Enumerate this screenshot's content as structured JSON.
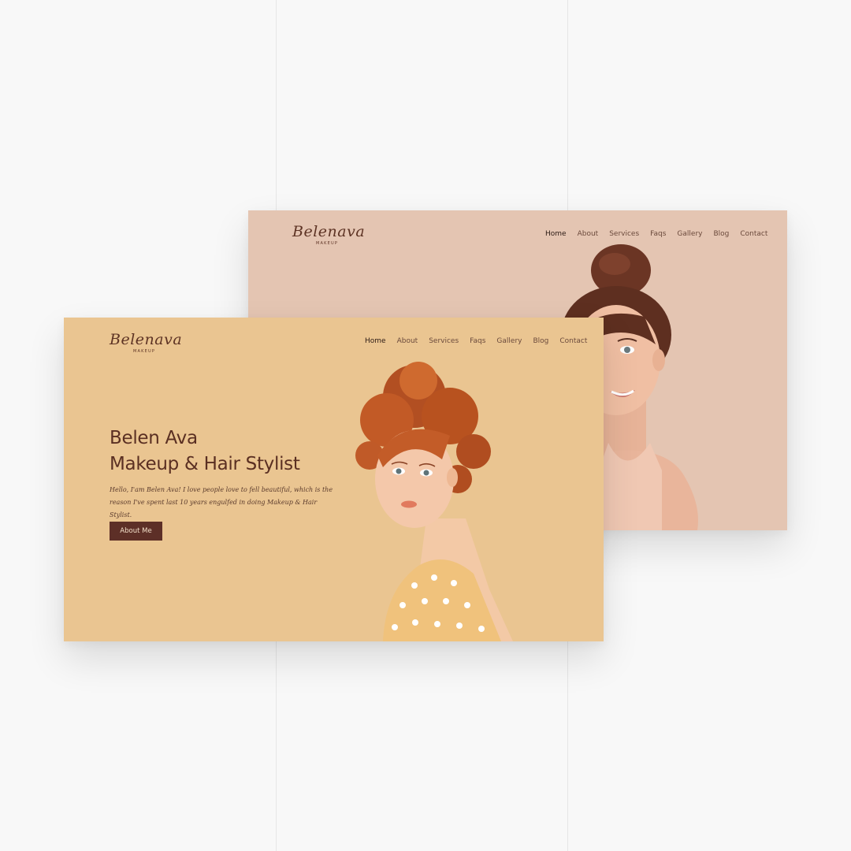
{
  "back_site": {
    "logo": {
      "script": "Belenava",
      "sub": "MAKEUP"
    },
    "nav": [
      {
        "label": "Home"
      },
      {
        "label": "About"
      },
      {
        "label": "Services"
      },
      {
        "label": "Faqs"
      },
      {
        "label": "Gallery"
      },
      {
        "label": "Blog"
      },
      {
        "label": "Contact"
      }
    ],
    "background": "#e4c5b2"
  },
  "front_site": {
    "logo": {
      "script": "Belenava",
      "sub": "MAKEUP"
    },
    "nav": [
      {
        "label": "Home"
      },
      {
        "label": "About"
      },
      {
        "label": "Services"
      },
      {
        "label": "Faqs"
      },
      {
        "label": "Gallery"
      },
      {
        "label": "Blog"
      },
      {
        "label": "Contact"
      }
    ],
    "hero": {
      "title_line1": "Belen Ava",
      "title_line2": "Makeup &  Hair Stylist",
      "text": "Hello, I'am Belen Ava! I love people love to fell beautiful, which is the reason I've spent last 10 years engulfed in doing Makeup & Hair Stylist.",
      "cta_label": "About  Me"
    },
    "background": "#eac591",
    "accent": "#5d2f27"
  }
}
